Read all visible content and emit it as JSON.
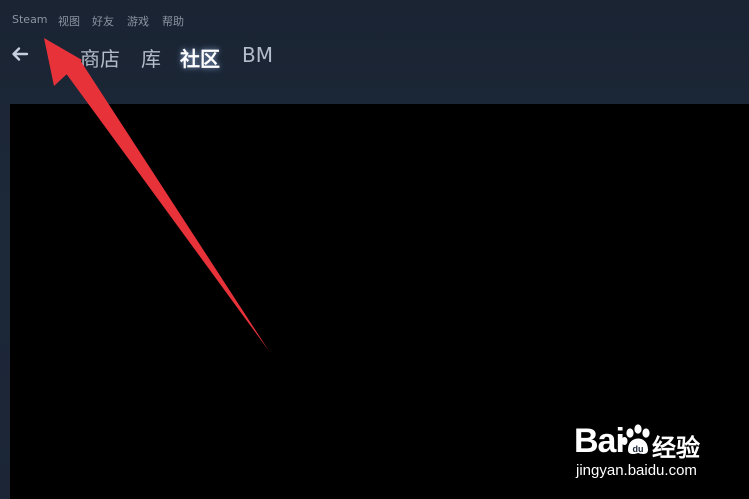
{
  "menu": {
    "items": [
      {
        "label": "Steam"
      },
      {
        "label": "视图"
      },
      {
        "label": "好友"
      },
      {
        "label": "游戏"
      },
      {
        "label": "帮助"
      }
    ]
  },
  "nav": {
    "back_icon": "back-arrow-icon",
    "items": [
      {
        "label": "商店",
        "active": false
      },
      {
        "label": "库",
        "active": false
      },
      {
        "label": "社区",
        "active": true
      },
      {
        "label": "BM",
        "active": false
      }
    ]
  },
  "annotation": {
    "color": "#e8323a",
    "target": "Steam"
  },
  "watermark": {
    "brand": "Bai",
    "brand_suffix": "经验",
    "url": "jingyan.baidu.com",
    "icon": "paw-icon"
  },
  "colors": {
    "background": "#1b2838",
    "content": "#000000",
    "menu_text": "#8a94a3",
    "nav_text": "#b4bdc9",
    "nav_active": "#ffffff"
  }
}
